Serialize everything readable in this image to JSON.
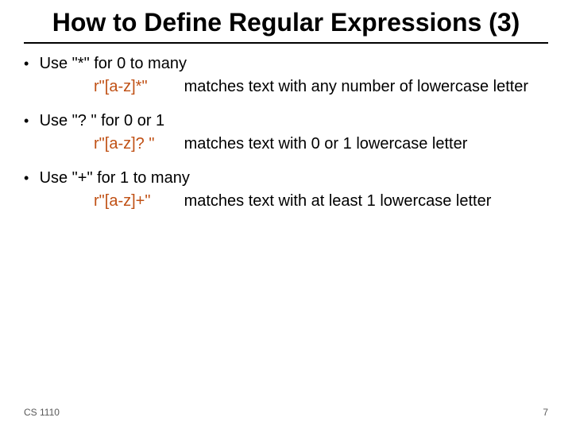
{
  "title": "How to Define Regular Expressions (3)",
  "bullets": [
    {
      "text": "Use \"*\"  for 0 to many",
      "code": "r\"[a-z]*\"",
      "desc": "matches text with any number of lowercase letter"
    },
    {
      "text": "Use \"? \"  for 0 or 1",
      "code": "r\"[a-z]? \"",
      "desc": "matches text with 0 or 1 lowercase letter"
    },
    {
      "text": "Use \"+\"  for 1 to many",
      "code": "r\"[a-z]+\"",
      "desc": "matches text with at least 1 lowercase letter"
    }
  ],
  "footer": {
    "left": "CS 1110",
    "right": "7"
  }
}
